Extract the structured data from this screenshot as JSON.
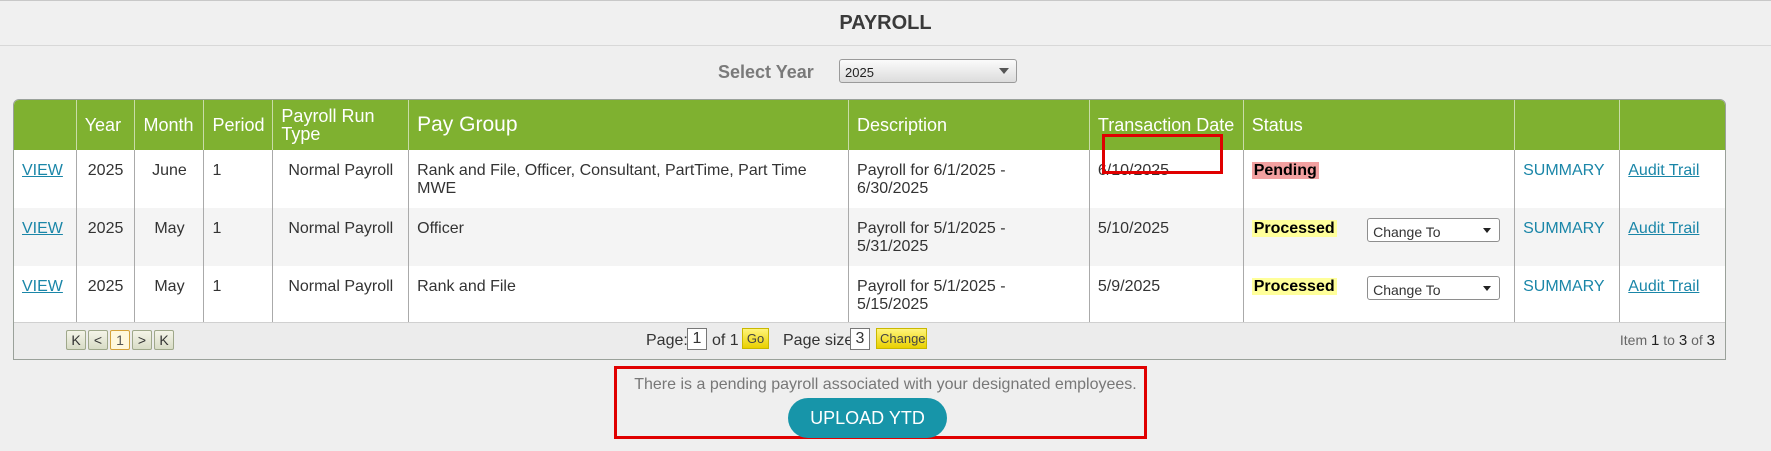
{
  "page": {
    "title": "PAYROLL"
  },
  "filter": {
    "label": "Select Year",
    "selected_year": "2025"
  },
  "table": {
    "headers": [
      "",
      "Year",
      "Month",
      "Period",
      "Payroll Run Type",
      "Pay Group",
      "Description",
      "Transaction Date",
      "Status",
      "",
      ""
    ],
    "rows": [
      {
        "view": "VIEW",
        "year": "2025",
        "month": "June",
        "period": "1",
        "run_type": "Normal Payroll",
        "pay_group": "Rank and File, Officer, Consultant, PartTime, Part Time MWE",
        "description": "Payroll for 6/1/2025 - 6/30/2025",
        "transaction_date": "6/10/2025",
        "status": "Pending",
        "change_to": "",
        "summary": "SUMMARY",
        "audit": "Audit Trail"
      },
      {
        "view": "VIEW",
        "year": "2025",
        "month": "May",
        "period": "1",
        "run_type": "Normal Payroll",
        "pay_group": "Officer",
        "description": "Payroll for 5/1/2025 - 5/31/2025",
        "transaction_date": "5/10/2025",
        "status": "Processed",
        "change_to": "Change To",
        "summary": "SUMMARY",
        "audit": "Audit Trail"
      },
      {
        "view": "VIEW",
        "year": "2025",
        "month": "May",
        "period": "1",
        "run_type": "Normal Payroll",
        "pay_group": "Rank and File",
        "description": "Payroll for 5/1/2025 - 5/15/2025",
        "transaction_date": "5/9/2025",
        "status": "Processed",
        "change_to": "Change To",
        "summary": "SUMMARY",
        "audit": "Audit Trail"
      }
    ]
  },
  "pager": {
    "first": "K",
    "prev": "<",
    "current": "1",
    "next": ">",
    "last": "K",
    "page_label": "Page:",
    "page_value": "1",
    "of_label": "of 1",
    "go_label": "Go",
    "page_size_label": "Page size:",
    "page_size_value": "3",
    "change_label": "Change",
    "item_prefix": "Item",
    "item_from": "1",
    "item_to_label": "to",
    "item_to": "3",
    "item_of_label": "of",
    "item_total": "3"
  },
  "notice": {
    "message": "There is a pending payroll associated with your designated employees.",
    "upload_label": "UPLOAD YTD"
  },
  "colors": {
    "header_green": "#7fb130",
    "link": "#1a86a8",
    "upload": "#1795a9",
    "highlight": "#e00000"
  }
}
